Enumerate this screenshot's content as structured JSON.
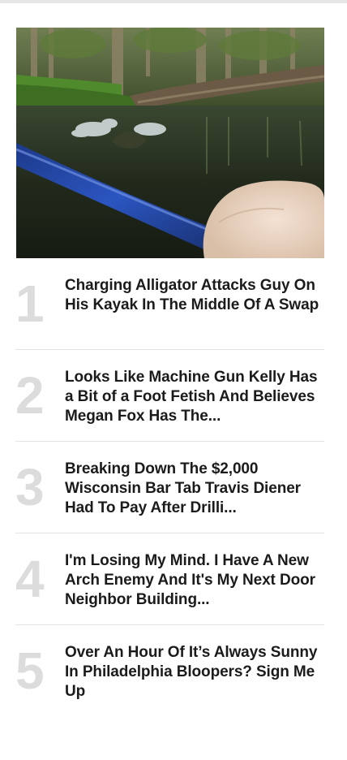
{
  "hero": {
    "image": "alligator-kayak-swamp-thumbnail"
  },
  "articles": [
    {
      "rank": "1",
      "title": "Charging Alligator Attacks Guy On His Kayak In The Middle Of A Swap"
    },
    {
      "rank": "2",
      "title": "Looks Like Machine Gun Kelly Has a Bit of a Foot Fetish And Believes Megan Fox Has The..."
    },
    {
      "rank": "3",
      "title": "Breaking Down The $2,000 Wisconsin Bar Tab Travis Diener Had To Pay After Drilli..."
    },
    {
      "rank": "4",
      "title": "I'm Losing My Mind. I Have A New Arch Enemy And It's My Next Door Neighbor Building..."
    },
    {
      "rank": "5",
      "title": "Over An Hour Of It’s Always Sunny In Philadelphia Bloopers? Sign Me Up"
    }
  ]
}
